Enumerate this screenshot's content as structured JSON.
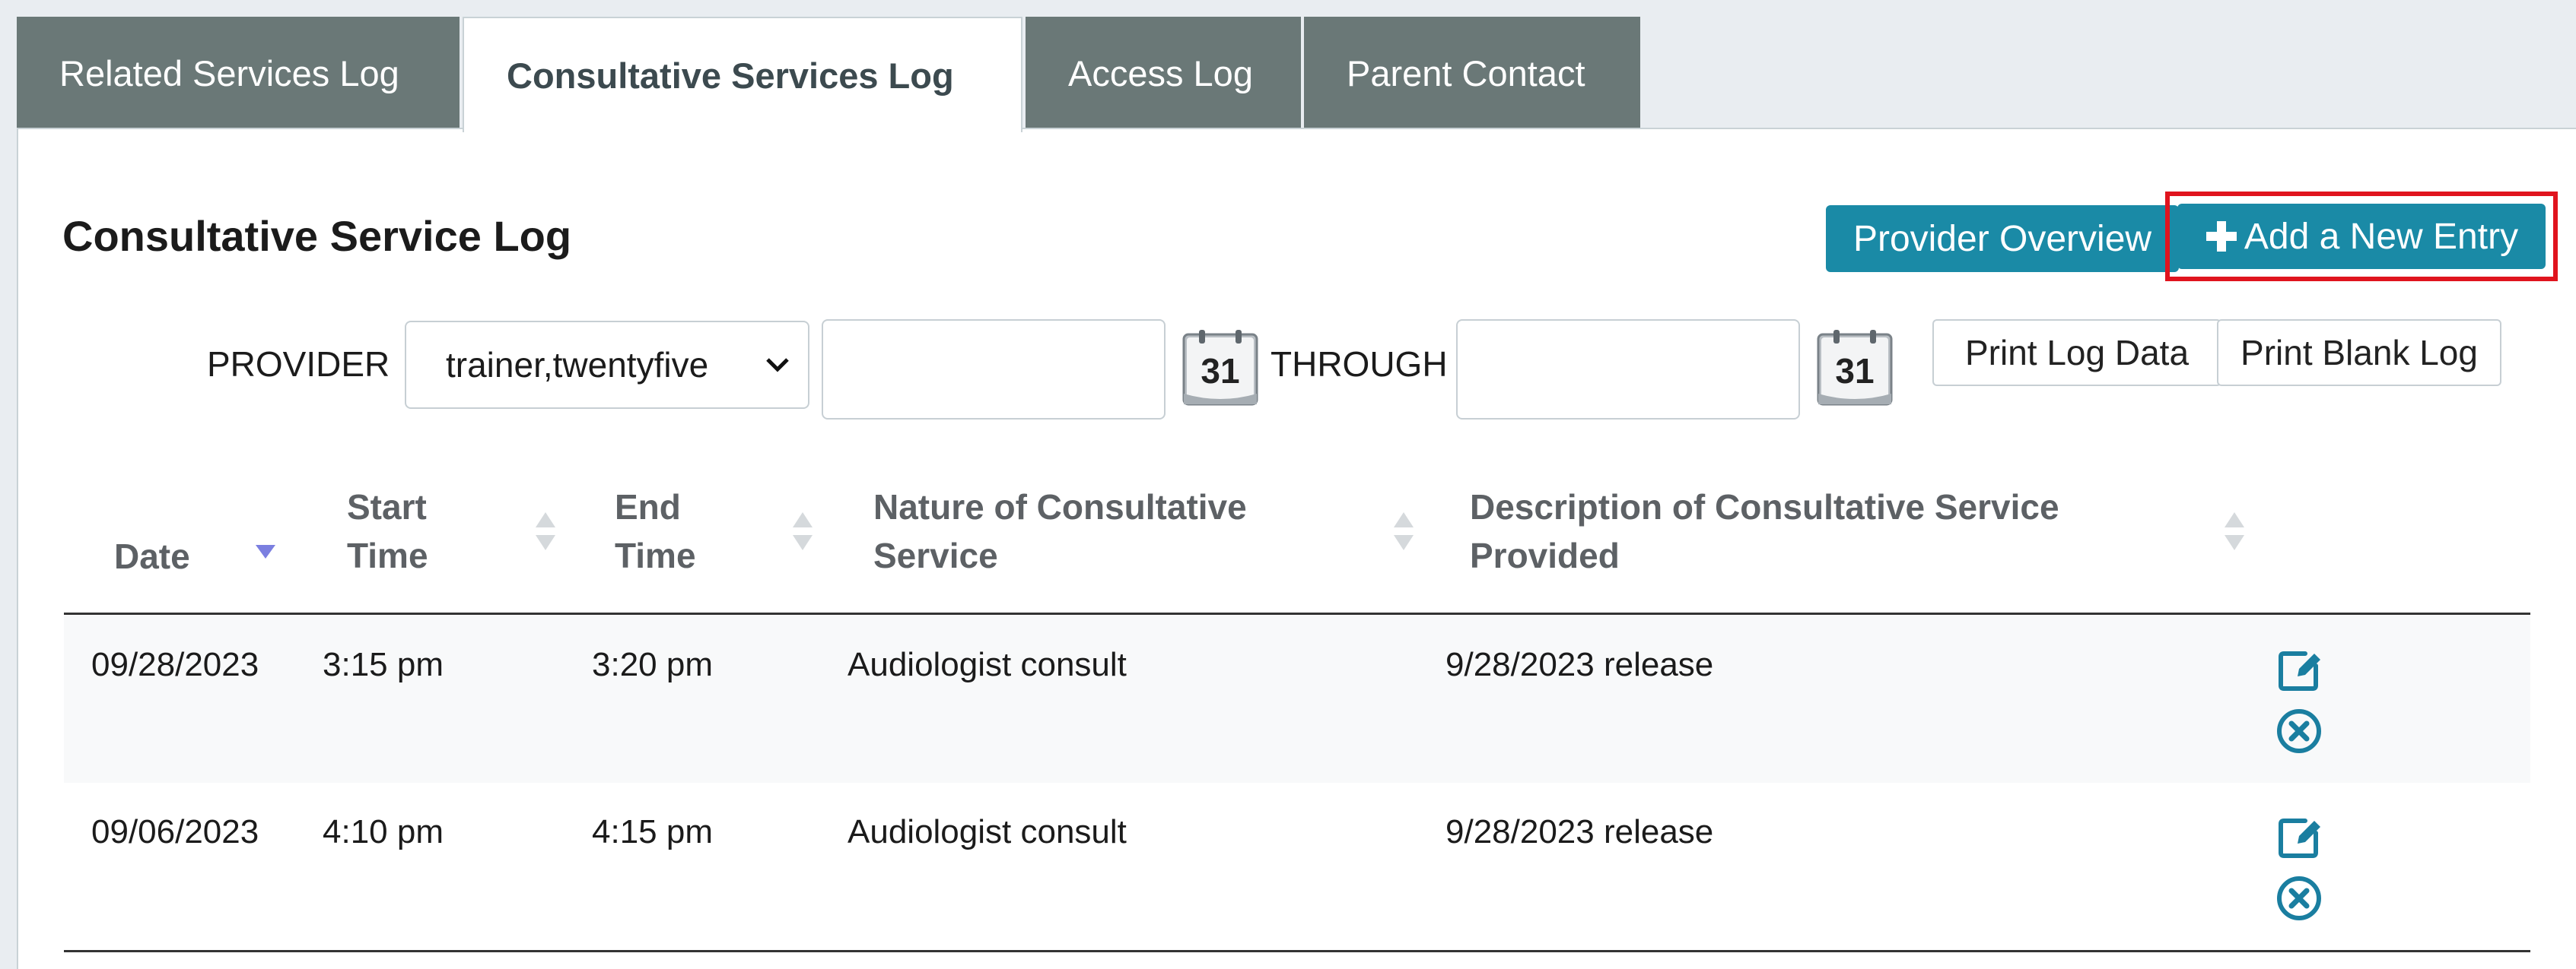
{
  "tabs": [
    {
      "label": "Related Services Log"
    },
    {
      "label": "Consultative Services Log"
    },
    {
      "label": "Access Log"
    },
    {
      "label": "Parent Contact"
    }
  ],
  "active_tab": "Consultative Services Log",
  "panel": {
    "title": "Consultative Service Log",
    "provider_overview_label": "Provider Overview",
    "add_entry_label": "Add a New Entry",
    "add_entry_highlighted": true
  },
  "filters": {
    "provider_label": "PROVIDER",
    "provider_value": "trainer,twentyfive",
    "from_date": "",
    "through_label": "THROUGH",
    "through_date": "",
    "calendar_day": "31",
    "print_log_label": "Print Log Data",
    "print_blank_label": "Print Blank Log"
  },
  "table": {
    "headers": {
      "date": "Date",
      "start": [
        "Start",
        "Time"
      ],
      "end": [
        "End",
        "Time"
      ],
      "nature": [
        "Nature of Consultative",
        "Service"
      ],
      "desc": [
        "Description of Consultative Service",
        "Provided"
      ]
    },
    "sort": {
      "column": "date",
      "direction": "desc"
    },
    "rows": [
      {
        "date": "09/28/2023",
        "start": "3:15 pm",
        "end": "3:20 pm",
        "nature": "Audiologist consult",
        "desc": "9/28/2023 release"
      },
      {
        "date": "09/06/2023",
        "start": "4:10 pm",
        "end": "4:15 pm",
        "nature": "Audiologist consult",
        "desc": "9/28/2023 release"
      }
    ]
  },
  "icons": {
    "edit": "edit-icon",
    "delete": "delete-circle-icon",
    "calendar": "calendar-icon",
    "plus": "plus-icon",
    "sort_active": "sort-desc-icon",
    "sort_inactive": "sort-both-icon",
    "chevron": "chevron-down-icon"
  },
  "colors": {
    "tab_bg": "#6a7877",
    "accent": "#1a8aa6",
    "highlight": "#e0141e",
    "sort_active": "#7b7fe0"
  }
}
